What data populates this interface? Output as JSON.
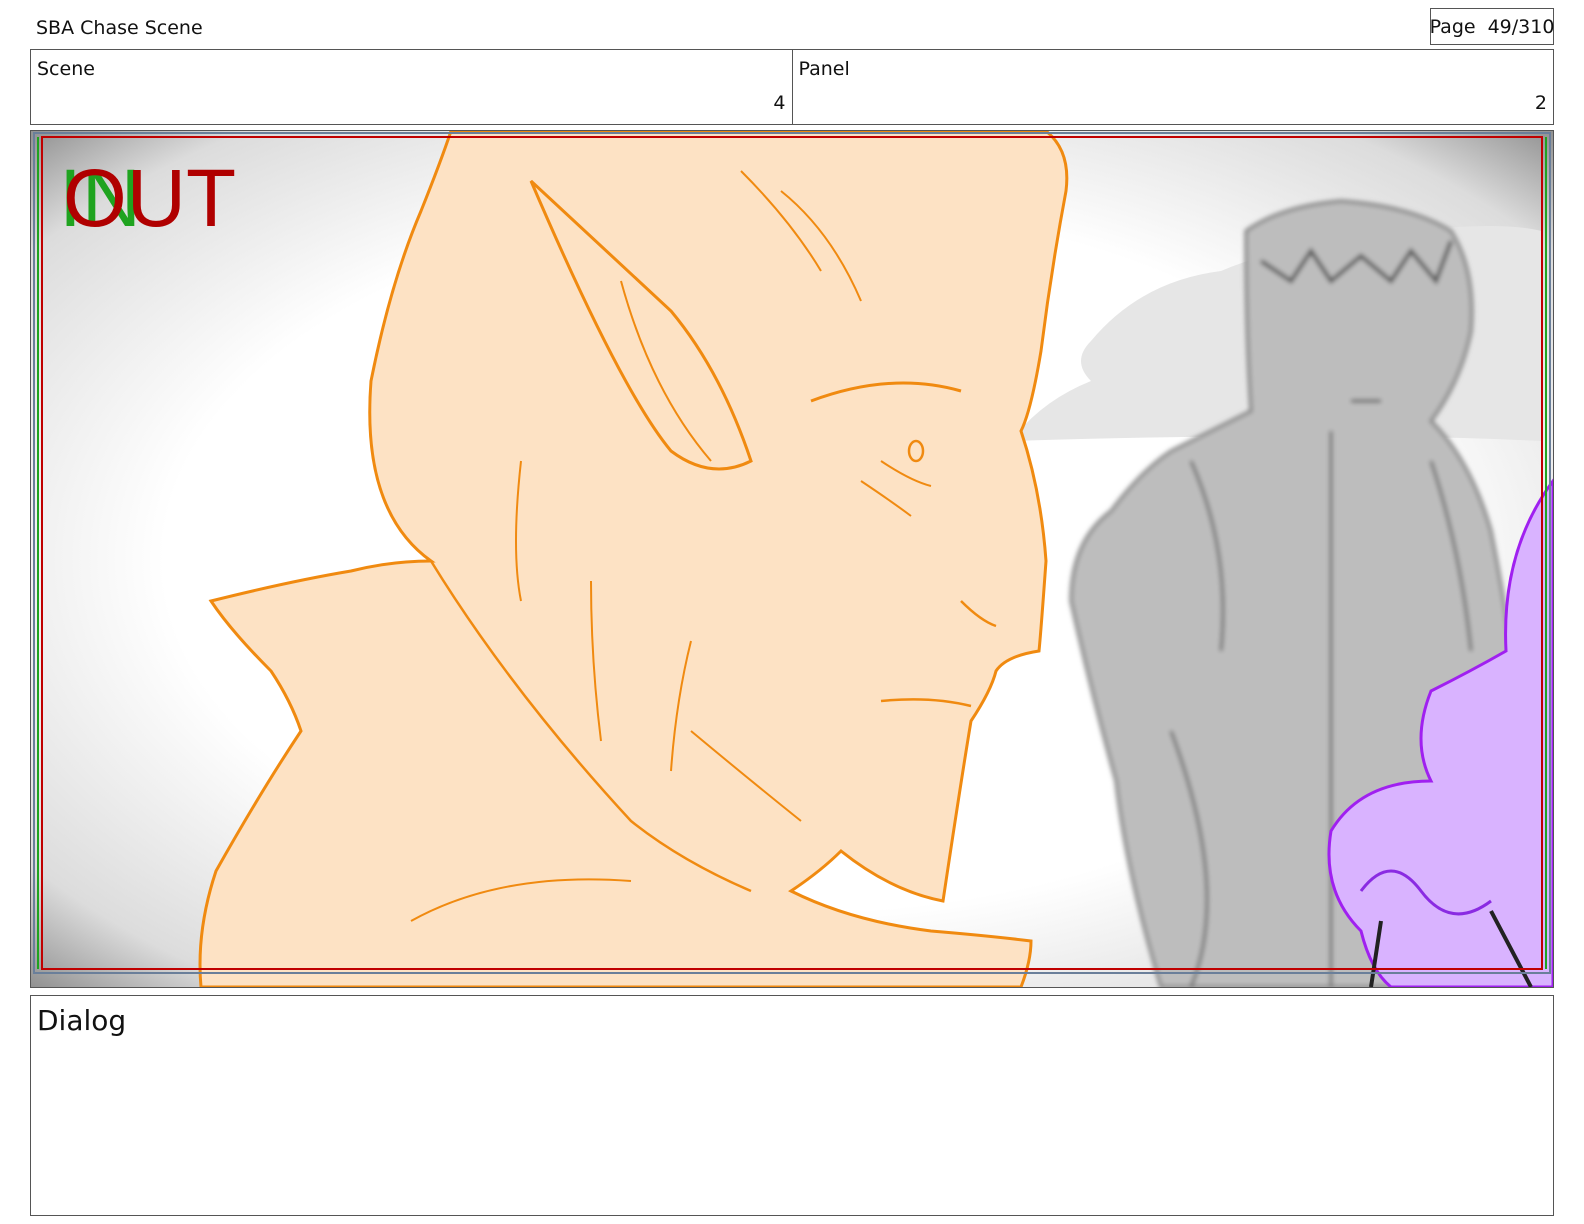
{
  "header": {
    "project_title": "SBA Chase Scene",
    "page_label": "Page",
    "page_number": "49/310"
  },
  "info": {
    "scene_label": "Scene",
    "scene_value": "4",
    "panel_label": "Panel",
    "panel_value": "2"
  },
  "frame": {
    "in_marker": "IN",
    "out_marker": "OUT",
    "colors": {
      "in_marker": "#1fa31f",
      "out_marker": "#b00000",
      "main_character_fill": "#fde2c4",
      "main_character_line": "#f08a10",
      "background_character": "#bdbdbd",
      "magic_effect": "#d9b3ff"
    }
  },
  "dialog": {
    "label": "Dialog"
  }
}
